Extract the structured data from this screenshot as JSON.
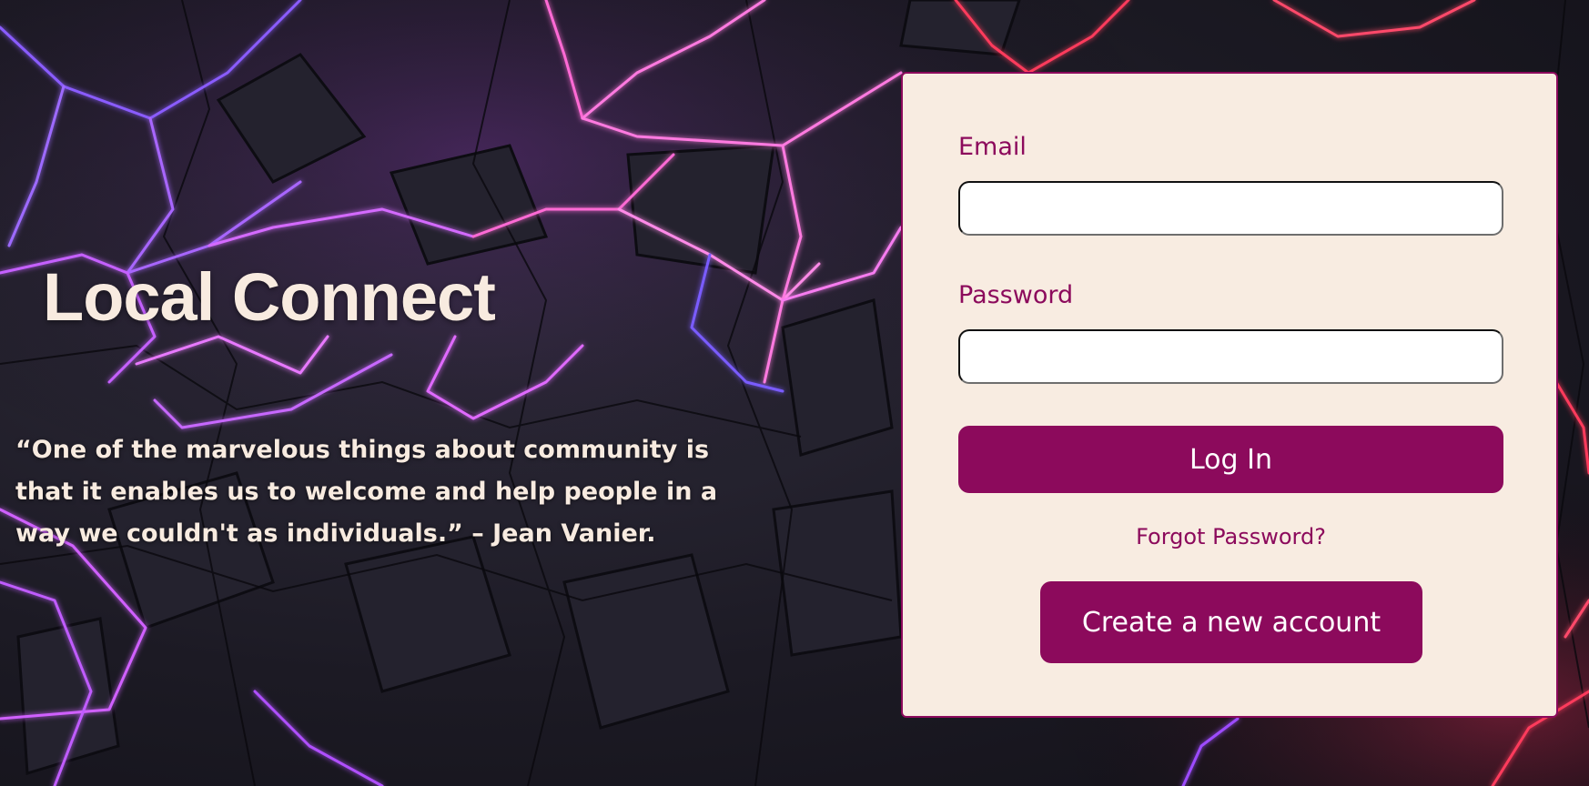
{
  "brand": {
    "title": "Local Connect",
    "quote": "“One of the marvelous things about community is that it enables us to welcome and help people in a way we couldn't as individuals.” – Jean Vanier."
  },
  "login_form": {
    "email_label": "Email",
    "email_value": "",
    "password_label": "Password",
    "password_value": "",
    "login_button": "Log In",
    "forgot_password": "Forgot Password?",
    "create_account_button": "Create a new account"
  },
  "colors": {
    "accent": "#8c0a5c",
    "card_background": "#f8ece1",
    "title_text": "#f8ebe0",
    "background_dark": "#1c1a24",
    "neon_purple": "#b25cff",
    "neon_pink": "#ff4fd8",
    "neon_red": "#ff3b5c"
  },
  "icons": {
    "background": "neon-polygon-mesh-image"
  }
}
